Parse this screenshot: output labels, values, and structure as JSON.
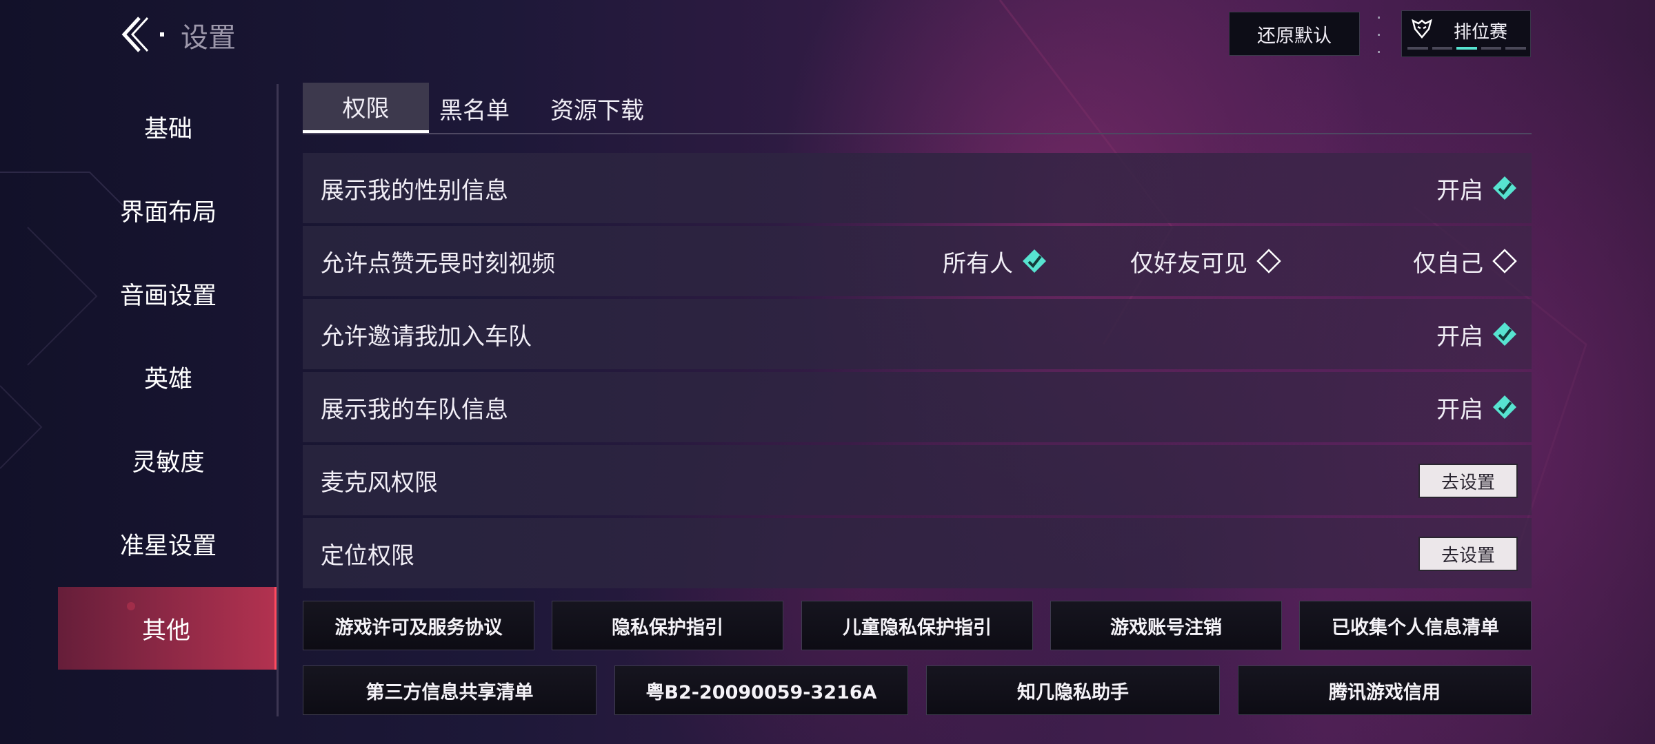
{
  "header": {
    "title": "设置",
    "reset_label": "还原默认",
    "mode_label": "排位赛",
    "mode_icon": "wolf-emblem-icon",
    "mode_progress": {
      "active_segment": 3,
      "total_segments": 5
    }
  },
  "sidebar": {
    "items": [
      {
        "label": "基础"
      },
      {
        "label": "界面布局"
      },
      {
        "label": "音画设置"
      },
      {
        "label": "英雄"
      },
      {
        "label": "灵敏度"
      },
      {
        "label": "准星设置"
      },
      {
        "label": "其他"
      }
    ],
    "active_index": 6
  },
  "tabs": {
    "items": [
      {
        "label": "权限"
      },
      {
        "label": "黑名单"
      },
      {
        "label": "资源下载"
      }
    ],
    "active_index": 0
  },
  "settings": {
    "gender": {
      "label": "展示我的性别信息",
      "value": "开启",
      "checked": true
    },
    "likes": {
      "label": "允许点赞无畏时刻视频",
      "options": [
        {
          "label": "所有人",
          "checked": true
        },
        {
          "label": "仅好友可见",
          "checked": false
        },
        {
          "label": "仅自己",
          "checked": false
        }
      ]
    },
    "invite": {
      "label": "允许邀请我加入车队",
      "value": "开启",
      "checked": true
    },
    "team_info": {
      "label": "展示我的车队信息",
      "value": "开启",
      "checked": true
    },
    "mic": {
      "label": "麦克风权限",
      "button": "去设置"
    },
    "location": {
      "label": "定位权限",
      "button": "去设置"
    }
  },
  "links": {
    "row1": [
      "游戏许可及服务协议",
      "隐私保护指引",
      "儿童隐私保护指引",
      "游戏账号注销",
      "已收集个人信息清单"
    ],
    "row2": [
      "第三方信息共享清单",
      "粤B2-20090059-3216A",
      "知几隐私助手",
      "腾讯游戏信用"
    ]
  },
  "colors": {
    "accent_teal": "#57e3d0",
    "active_red": "#ff4b5f"
  }
}
